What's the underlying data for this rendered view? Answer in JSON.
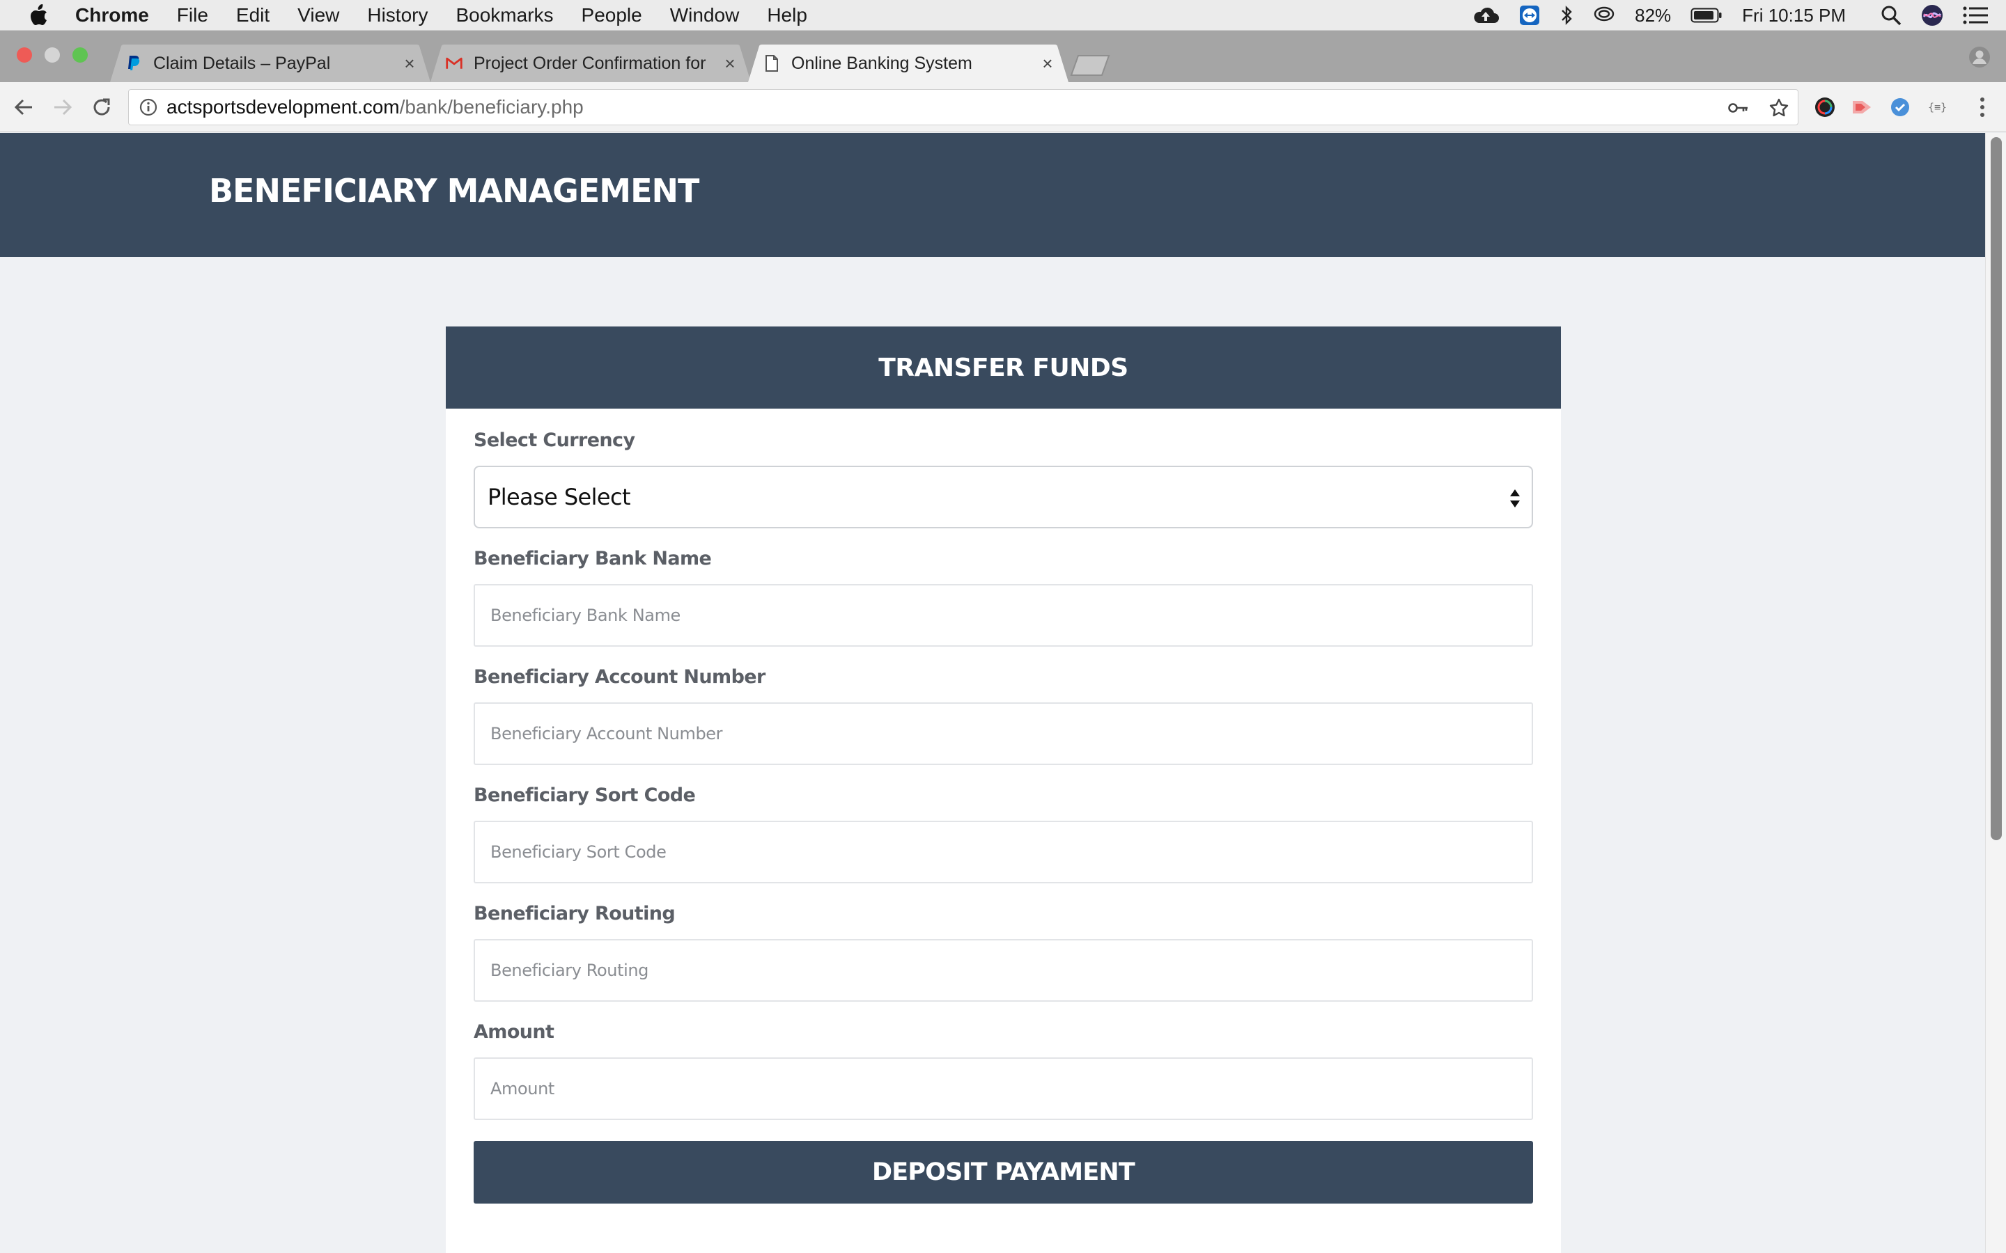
{
  "menubar": {
    "app_name": "Chrome",
    "items": [
      "File",
      "Edit",
      "View",
      "History",
      "Bookmarks",
      "People",
      "Window",
      "Help"
    ],
    "battery": "82%",
    "clock": "Fri 10:15 PM"
  },
  "tabs": [
    {
      "title": "Claim Details – PayPal",
      "favicon": "paypal-icon"
    },
    {
      "title": "Project Order Confirmation for",
      "favicon": "gmail-icon"
    },
    {
      "title": "Online Banking System",
      "favicon": "document-icon",
      "active": true
    }
  ],
  "toolbar": {
    "url_host": "actsportsdevelopment.com",
    "url_path": "/bank/beneficiary.php"
  },
  "page": {
    "title": "BENEFICIARY MANAGEMENT"
  },
  "form": {
    "title": "TRANSFER FUNDS",
    "currency": {
      "label": "Select Currency",
      "value": "Please Select"
    },
    "bank_name": {
      "label": "Beneficiary Bank Name",
      "placeholder": "Beneficiary Bank Name"
    },
    "account_number": {
      "label": "Beneficiary Account Number",
      "placeholder": "Beneficiary Account Number"
    },
    "sort_code": {
      "label": "Beneficiary Sort Code",
      "placeholder": "Beneficiary Sort Code"
    },
    "routing": {
      "label": "Beneficiary Routing",
      "placeholder": "Beneficiary Routing"
    },
    "amount": {
      "label": "Amount",
      "placeholder": "Amount"
    },
    "submit_label": "DEPOSIT PAYAMENT"
  },
  "colors": {
    "header_band": "#394a5e",
    "page_bg": "#eff1f4",
    "card_bg": "#ffffff"
  }
}
